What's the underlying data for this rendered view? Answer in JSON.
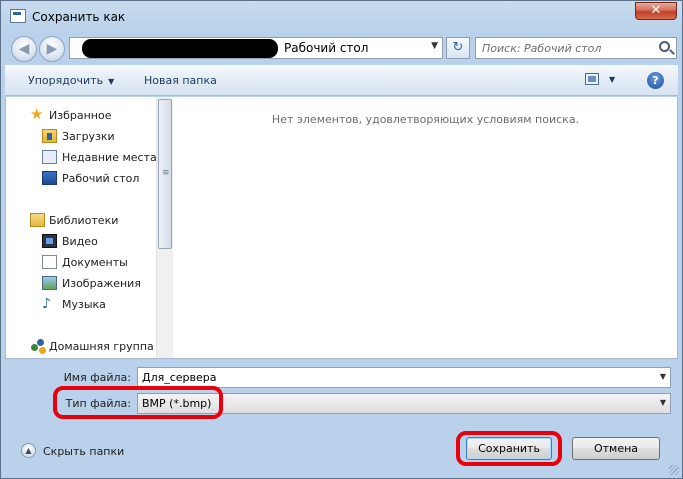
{
  "window": {
    "title": "Сохранить как",
    "close_label": "✕"
  },
  "address": {
    "current": "Рабочий стол"
  },
  "search": {
    "placeholder": "Поиск: Рабочий стол"
  },
  "toolbar": {
    "organize_label": "Упорядочить",
    "new_folder_label": "Новая папка",
    "help_label": "?"
  },
  "nav": {
    "favorites": "Избранное",
    "downloads": "Загрузки",
    "recent": "Недавние места",
    "desktop": "Рабочий стол",
    "libraries": "Библиотеки",
    "video": "Видео",
    "documents": "Документы",
    "images": "Изображения",
    "music": "Музыка",
    "homegroup": "Домашняя группа"
  },
  "file_pane": {
    "empty_message": "Нет элементов, удовлетворяющих условиям поиска."
  },
  "form": {
    "filename_label": "Имя файла:",
    "filename_value": "Для_сервера",
    "filetype_label": "Тип файла:",
    "filetype_value": "BMP (*.bmp)"
  },
  "footer": {
    "hide_folders_label": "Скрыть папки",
    "save_label": "Сохранить",
    "cancel_label": "Отмена"
  }
}
